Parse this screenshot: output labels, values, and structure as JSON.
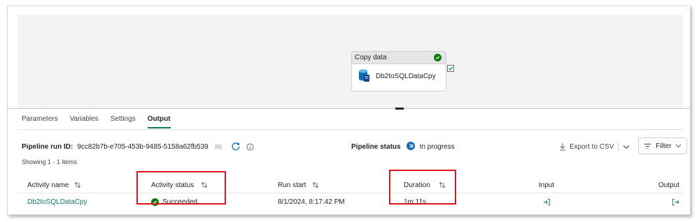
{
  "canvas": {
    "activity": {
      "type_label": "Copy data",
      "name": "Db2toSQLDataCpy",
      "icon": "database-icon",
      "status_icon": "success-check-icon"
    }
  },
  "tabs": [
    {
      "label": "Parameters",
      "active": false
    },
    {
      "label": "Variables",
      "active": false
    },
    {
      "label": "Settings",
      "active": false
    },
    {
      "label": "Output",
      "active": true
    }
  ],
  "run_info": {
    "run_id_label": "Pipeline run ID:",
    "run_id": "9cc82b7b-e705-453b-9485-5158a62fb539",
    "pipeline_status_label": "Pipeline status",
    "pipeline_status": "In progress",
    "export_label": "Export to CSV",
    "filter_label": "Filter",
    "showing": "Showing 1 - 1 items"
  },
  "table": {
    "columns": [
      "Activity name",
      "Activity status",
      "Run start",
      "Duration",
      "Input",
      "Output"
    ],
    "rows": [
      {
        "activity_name": "Db2toSQLDataCpy",
        "activity_status": "Succeeded",
        "run_start": "8/1/2024, 8:17:42 PM",
        "duration": "1m 11s"
      }
    ]
  },
  "colors": {
    "accent": "#117865",
    "success": "#107c10",
    "in_progress": "#0f6cbd",
    "highlight": "#e0161c"
  }
}
